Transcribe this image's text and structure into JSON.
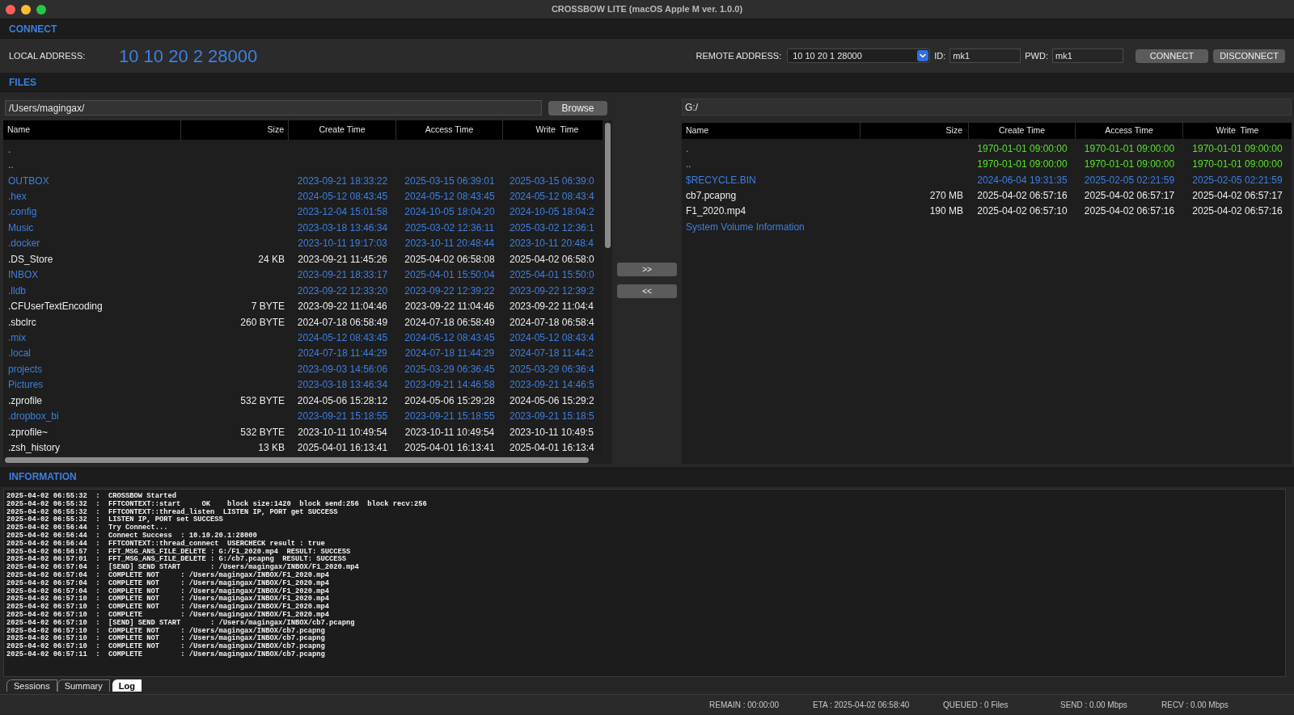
{
  "window": {
    "title": "CROSSBOW LITE (macOS Apple M ver. 1.0.0)"
  },
  "connect": {
    "heading": "CONNECT",
    "local_label": "LOCAL ADDRESS:",
    "local_address": "10 10 20 2 28000",
    "remote_label": "REMOTE ADDRESS:",
    "remote_address": "10 10 20 1 28000",
    "id_label": "ID:",
    "id_value": "mk1",
    "pwd_label": "PWD:",
    "pwd_value": "mk1",
    "buttons": [
      "CONNECT",
      "DISCONNECT"
    ]
  },
  "files": {
    "heading": "FILES",
    "local": {
      "path": "/Users/magingax/",
      "browse_button": "Browse",
      "columns": [
        "Name",
        "Size",
        "Create Time",
        "Access Time",
        "Write  Time"
      ],
      "rows": [
        {
          "kind": "parent",
          "name": "."
        },
        {
          "kind": "parent",
          "name": ".."
        },
        {
          "kind": "dir",
          "name": "OUTBOX",
          "create": "2023-09-21 18:33:22",
          "access": "2025-03-15 06:39:01",
          "write": "2025-03-15 06:39:0"
        },
        {
          "kind": "dir",
          "name": ".hex",
          "create": "2024-05-12 08:43:45",
          "access": "2024-05-12 08:43:45",
          "write": "2024-05-12 08:43:4"
        },
        {
          "kind": "dir",
          "name": ".config",
          "create": "2023-12-04 15:01:58",
          "access": "2024-10-05 18:04:20",
          "write": "2024-10-05 18:04:2"
        },
        {
          "kind": "dir",
          "name": "Music",
          "create": "2023-03-18 13:46:34",
          "access": "2025-03-02 12:36:11",
          "write": "2025-03-02 12:36:1"
        },
        {
          "kind": "dir",
          "name": ".docker",
          "create": "2023-10-11 19:17:03",
          "access": "2023-10-11 20:48:44",
          "write": "2023-10-11 20:48:4"
        },
        {
          "kind": "file",
          "name": ".DS_Store",
          "size": "24 KB",
          "create": "2023-09-21 11:45:26",
          "access": "2025-04-02 06:58:08",
          "write": "2025-04-02 06:58:0"
        },
        {
          "kind": "dir",
          "name": "INBOX",
          "create": "2023-09-21 18:33:17",
          "access": "2025-04-01 15:50:04",
          "write": "2025-04-01 15:50:0"
        },
        {
          "kind": "dir",
          "name": ".lldb",
          "create": "2023-09-22 12:33:20",
          "access": "2023-09-22 12:39:22",
          "write": "2023-09-22 12:39:2"
        },
        {
          "kind": "file",
          "name": ".CFUserTextEncoding",
          "size": "7 BYTE",
          "create": "2023-09-22 11:04:46",
          "access": "2023-09-22 11:04:46",
          "write": "2023-09-22 11:04:4"
        },
        {
          "kind": "file",
          "name": ".sbclrc",
          "size": "260 BYTE",
          "create": "2024-07-18 06:58:49",
          "access": "2024-07-18 06:58:49",
          "write": "2024-07-18 06:58:4"
        },
        {
          "kind": "dir",
          "name": ".mix",
          "create": "2024-05-12 08:43:45",
          "access": "2024-05-12 08:43:45",
          "write": "2024-05-12 08:43:4"
        },
        {
          "kind": "dir",
          "name": ".local",
          "create": "2024-07-18 11:44:29",
          "access": "2024-07-18 11:44:29",
          "write": "2024-07-18 11:44:2"
        },
        {
          "kind": "dir",
          "name": "projects",
          "create": "2023-09-03 14:56:06",
          "access": "2025-03-29 06:36:45",
          "write": "2025-03-29 06:36:4"
        },
        {
          "kind": "dir",
          "name": "Pictures",
          "create": "2023-03-18 13:46:34",
          "access": "2023-09-21 14:46:58",
          "write": "2023-09-21 14:46:5"
        },
        {
          "kind": "file",
          "name": ".zprofile",
          "size": "532 BYTE",
          "create": "2024-05-06 15:28:12",
          "access": "2024-05-06 15:29:28",
          "write": "2024-05-06 15:29:2"
        },
        {
          "kind": "dir",
          "name": ".dropbox_bi",
          "create": "2023-09-21 15:18:55",
          "access": "2023-09-21 15:18:55",
          "write": "2023-09-21 15:18:5"
        },
        {
          "kind": "file",
          "name": ".zprofile~",
          "size": "532 BYTE",
          "create": "2023-10-11 10:49:54",
          "access": "2023-10-11 10:49:54",
          "write": "2023-10-11 10:49:5"
        },
        {
          "kind": "file",
          "name": ".zsh_history",
          "size": "13 KB",
          "create": "2025-04-01 16:13:41",
          "access": "2025-04-01 16:13:41",
          "write": "2025-04-01 16:13:4"
        }
      ]
    },
    "transfer_buttons": [
      ">>",
      "<<"
    ],
    "remote": {
      "path": "G:/",
      "columns": [
        "Name",
        "Size",
        "Create Time",
        "Access Time",
        "Write  Time"
      ],
      "rows": [
        {
          "kind": "parent",
          "name": ".",
          "create": "1970-01-01 09:00:00",
          "access": "1970-01-01 09:00:00",
          "write": "1970-01-01 09:00:00"
        },
        {
          "kind": "parent",
          "name": "..",
          "create": "1970-01-01 09:00:00",
          "access": "1970-01-01 09:00:00",
          "write": "1970-01-01 09:00:00"
        },
        {
          "kind": "dir",
          "name": "$RECYCLE.BIN",
          "create": "2024-06-04 19:31:35",
          "access": "2025-02-05 02:21:59",
          "write": "2025-02-05 02:21:59"
        },
        {
          "kind": "file",
          "name": "cb7.pcapng",
          "size": "270 MB",
          "create": "2025-04-02 06:57:16",
          "access": "2025-04-02 06:57:17",
          "write": "2025-04-02 06:57:17"
        },
        {
          "kind": "file",
          "name": "F1_2020.mp4",
          "size": "190 MB",
          "create": "2025-04-02 06:57:10",
          "access": "2025-04-02 06:57:16",
          "write": "2025-04-02 06:57:16"
        },
        {
          "kind": "dir",
          "name": "System Volume Information"
        }
      ]
    }
  },
  "information": {
    "heading": "INFORMATION",
    "log": [
      "2025-04-02 06:55:32  :  CROSSBOW Started",
      "2025-04-02 06:55:32  :  FFTCONTEXT::start     OK    block size:1420  block send:256  block recv:256",
      "2025-04-02 06:55:32  :  FFTCONTEXT::thread_listen  LISTEN IP, PORT get SUCCESS",
      "2025-04-02 06:55:32  :  LISTEN IP, PORT set SUCCESS",
      "2025-04-02 06:56:44  :  Try Connect...",
      "2025-04-02 06:56:44  :  Connect Success  : 10.10.20.1:28000",
      "2025-04-02 06:56:44  :  FFTCONTEXT::thread_connect  USERCHECK result : true",
      "2025-04-02 06:56:57  :  FFT_MSG_ANS_FILE_DELETE : G:/F1_2020.mp4  RESULT: SUCCESS",
      "2025-04-02 06:57:01  :  FFT_MSG_ANS_FILE_DELETE : G:/cb7.pcapng  RESULT: SUCCESS",
      "2025-04-02 06:57:04  :  [SEND] SEND START       : /Users/magingax/INBOX/F1_2020.mp4",
      "2025-04-02 06:57:04  :  COMPLETE NOT     : /Users/magingax/INBOX/F1_2020.mp4",
      "2025-04-02 06:57:04  :  COMPLETE NOT     : /Users/magingax/INBOX/F1_2020.mp4",
      "2025-04-02 06:57:04  :  COMPLETE NOT     : /Users/magingax/INBOX/F1_2020.mp4",
      "2025-04-02 06:57:10  :  COMPLETE NOT     : /Users/magingax/INBOX/F1_2020.mp4",
      "2025-04-02 06:57:10  :  COMPLETE NOT     : /Users/magingax/INBOX/F1_2020.mp4",
      "2025-04-02 06:57:10  :  COMPLETE         : /Users/magingax/INBOX/F1_2020.mp4",
      "2025-04-02 06:57:10  :  [SEND] SEND START       : /Users/magingax/INBOX/cb7.pcapng",
      "2025-04-02 06:57:10  :  COMPLETE NOT     : /Users/magingax/INBOX/cb7.pcapng",
      "2025-04-02 06:57:10  :  COMPLETE NOT     : /Users/magingax/INBOX/cb7.pcapng",
      "2025-04-02 06:57:10  :  COMPLETE NOT     : /Users/magingax/INBOX/cb7.pcapng",
      "2025-04-02 06:57:11  :  COMPLETE         : /Users/magingax/INBOX/cb7.pcapng"
    ],
    "tabs": [
      {
        "label": "Sessions",
        "selected": false
      },
      {
        "label": "Summary",
        "selected": false
      },
      {
        "label": "Log",
        "selected": true
      }
    ]
  },
  "status_bar": [
    "REMAIN : 00:00:00",
    "ETA : 2025-04-02 06:58:40",
    "QUEUED : 0 Files",
    "SEND : 0.00 Mbps",
    "RECV : 0.00 Mbps"
  ]
}
